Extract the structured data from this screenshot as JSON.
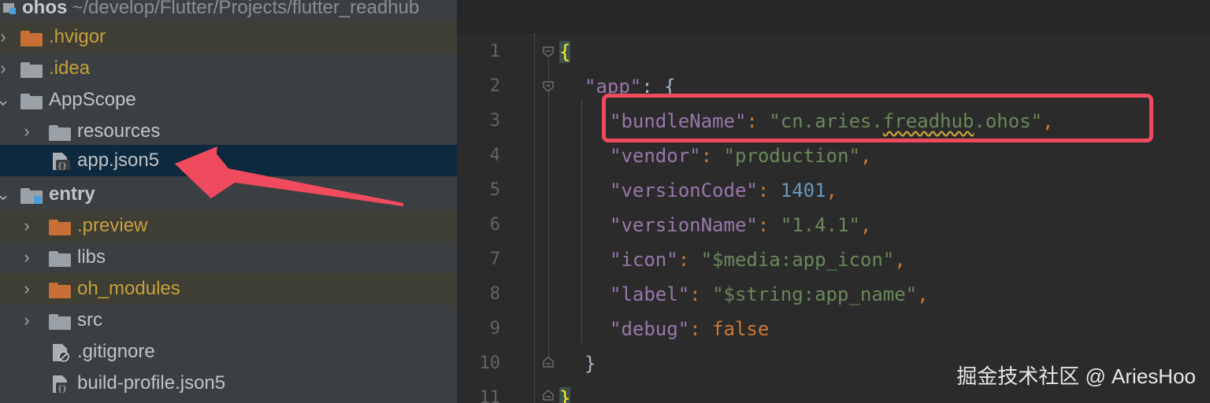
{
  "project": {
    "name": "ohos",
    "path": "~/develop/Flutter/Projects/flutter_readhub"
  },
  "tree": {
    "items": [
      {
        "label": ".hvigor",
        "arrow": "›"
      },
      {
        "label": ".idea",
        "arrow": "›"
      },
      {
        "label": "AppScope",
        "arrow": "⌄"
      },
      {
        "label": "resources",
        "arrow": "›"
      },
      {
        "label": "app.json5",
        "icon": "json5-file-icon"
      },
      {
        "label": "entry",
        "arrow": "⌄"
      },
      {
        "label": ".preview",
        "arrow": "›"
      },
      {
        "label": "libs",
        "arrow": "›"
      },
      {
        "label": "oh_modules",
        "arrow": "›"
      },
      {
        "label": "src",
        "arrow": "›"
      },
      {
        "label": ".gitignore",
        "icon": "gitignore-file-icon"
      },
      {
        "label": "build-profile.json5",
        "icon": "json5-file-icon"
      }
    ]
  },
  "editor": {
    "line_numbers": [
      "1",
      "2",
      "3",
      "4",
      "5",
      "6",
      "7",
      "8",
      "9",
      "10",
      "11"
    ],
    "code": {
      "l1_open": "{",
      "l2_key": "\"app\"",
      "l2_rest": ": {",
      "l3_key": "\"bundleName\"",
      "l3_colon": ": ",
      "l3_val_a": "\"cn.aries.",
      "l3_val_b": "freadhub",
      "l3_val_c": ".ohos\"",
      "l3_comma": ",",
      "l4_key": "\"vendor\"",
      "l4_colon": ": ",
      "l4_val": "\"production\"",
      "l4_comma": ",",
      "l5_key": "\"versionCode\"",
      "l5_colon": ": ",
      "l5_val": "1401",
      "l5_comma": ",",
      "l6_key": "\"versionName\"",
      "l6_colon": ": ",
      "l6_val": "\"1.4.1\"",
      "l6_comma": ",",
      "l7_key": "\"icon\"",
      "l7_colon": ": ",
      "l7_val": "\"$media:app_icon\"",
      "l7_comma": ",",
      "l8_key": "\"label\"",
      "l8_colon": ": ",
      "l8_val": "\"$string:app_name\"",
      "l8_comma": ",",
      "l9_key": "\"debug\"",
      "l9_colon": ": ",
      "l9_val": "false",
      "l10_close": "}",
      "l11_close": "}"
    }
  },
  "watermark": "掘金技术社区 @ AriesHoo",
  "colors": {
    "annotation_red": "#f04a5e",
    "selection": "#0d293e",
    "key_purple": "#9876aa",
    "string_green": "#6a8759",
    "number_blue": "#6897bb",
    "keyword_orange": "#cc7832"
  }
}
